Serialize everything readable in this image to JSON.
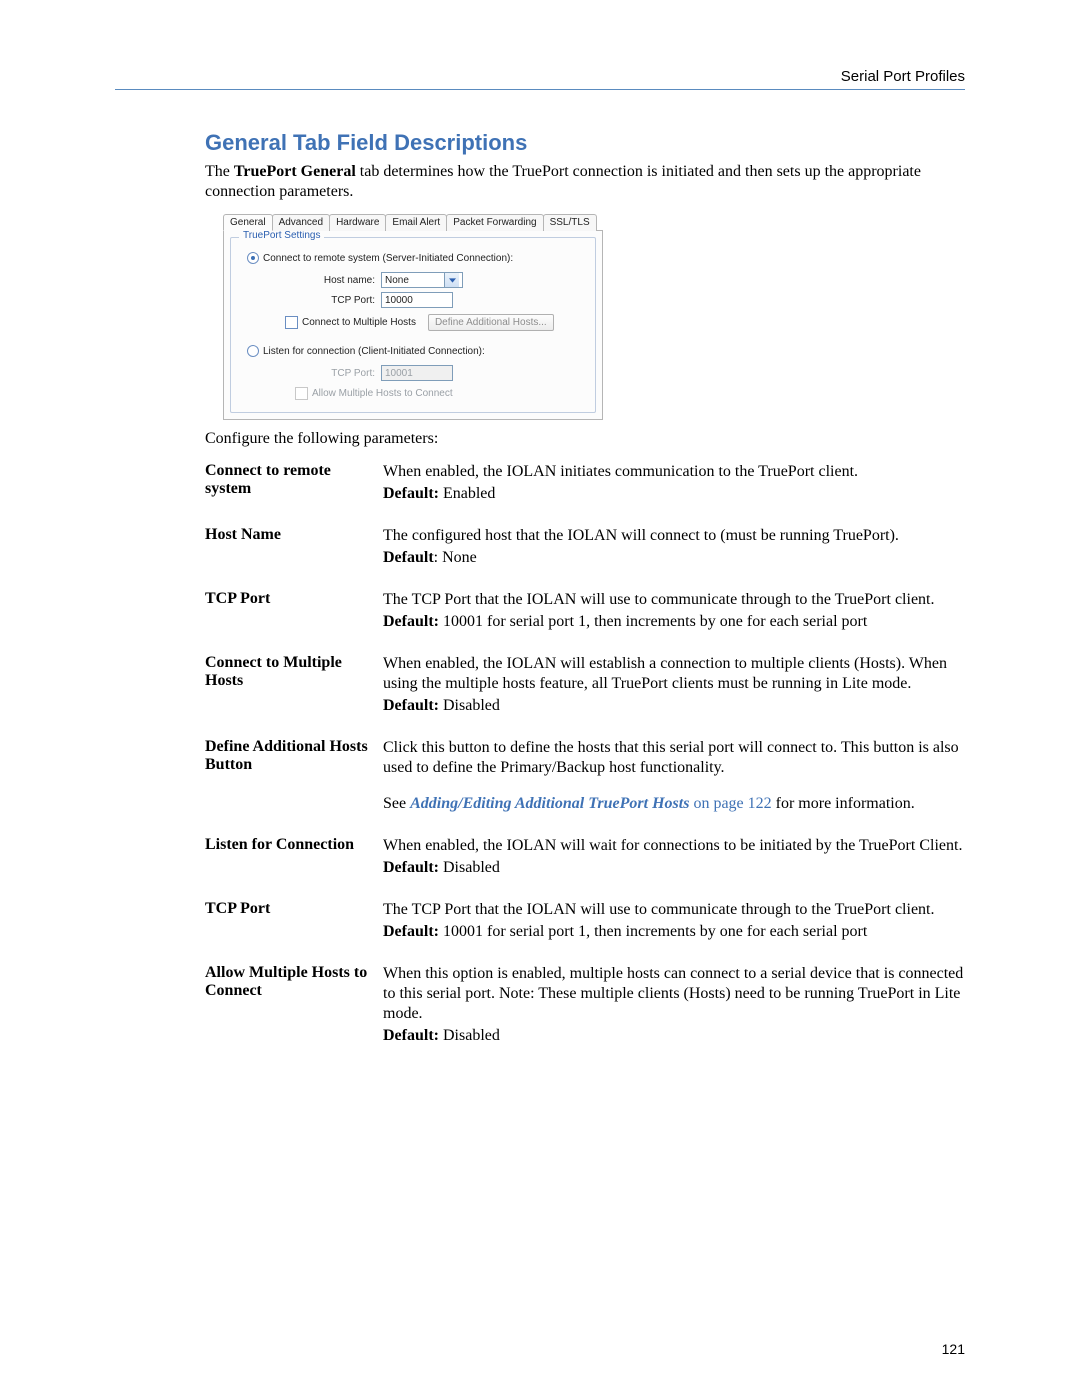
{
  "header": {
    "breadcrumb": "Serial Port Profiles"
  },
  "title": "General Tab Field Descriptions",
  "intro_prefix": "The ",
  "intro_bold": "TruePort General",
  "intro_suffix": " tab determines how the TruePort connection is initiated and then sets up the appropriate connection parameters.",
  "shot": {
    "tabs": [
      "General",
      "Advanced",
      "Hardware",
      "Email Alert",
      "Packet Forwarding",
      "SSL/TLS"
    ],
    "legend": "TruePort Settings",
    "radio1": "Connect to remote system (Server-Initiated Connection):",
    "hostname_label": "Host name:",
    "hostname_value": "None",
    "tcpport_label": "TCP Port:",
    "tcpport_value": "10000",
    "cb_multi": "Connect to Multiple Hosts",
    "btn_define": "Define Additional Hosts...",
    "radio2": "Listen for connection (Client-Initiated Connection):",
    "tcpport2_label": "TCP Port:",
    "tcpport2_value": "10001",
    "cb_allow": "Allow Multiple Hosts to Connect"
  },
  "config_line": "Configure the following parameters:",
  "link_text": "Adding/Editing Additional TruePort Hosts",
  "link_suffix": " on page 122",
  "see_prefix": "See ",
  "see_suffix": " for more information.",
  "params": [
    {
      "name": "Connect to remote system",
      "desc": "When enabled, the IOLAN initiates communication to the TruePort client.",
      "default": "Enabled"
    },
    {
      "name": "Host Name",
      "desc": "The configured host that the IOLAN will connect to (must be running TruePort).",
      "default": "None",
      "default_sep": ": "
    },
    {
      "name": "TCP Port",
      "desc": "The TCP Port that the IOLAN will use to communicate through to the TruePort client.",
      "default": "10001 for serial port 1, then increments by one for each serial port"
    },
    {
      "name": "Connect to Multiple Hosts",
      "desc": "When enabled, the IOLAN will establish a connection to multiple clients (Hosts). When using the multiple hosts feature, all TruePort clients must be running in Lite mode.",
      "default": "Disabled"
    },
    {
      "name": "Define Additional Hosts Button",
      "desc": "Click this button to define the hosts that this serial port will connect to. This button is also used to define the Primary/Backup host functionality.",
      "has_link": true
    },
    {
      "name": "Listen for Connection",
      "desc": "When enabled, the IOLAN will wait for connections to be initiated by the TruePort Client.",
      "default": "Disabled"
    },
    {
      "name": "TCP Port",
      "desc": "The TCP Port that the IOLAN will use to communicate through to the TruePort client.",
      "default": "10001 for serial port 1, then increments by one for each serial port"
    },
    {
      "name": "Allow Multiple Hosts to Connect",
      "desc": "When this option is enabled, multiple hosts can connect to a serial device that is connected to this serial port. Note: These multiple clients (Hosts) need to be running TruePort in Lite mode.",
      "default": "Disabled"
    }
  ],
  "default_label": "Default:",
  "page_number": "121"
}
